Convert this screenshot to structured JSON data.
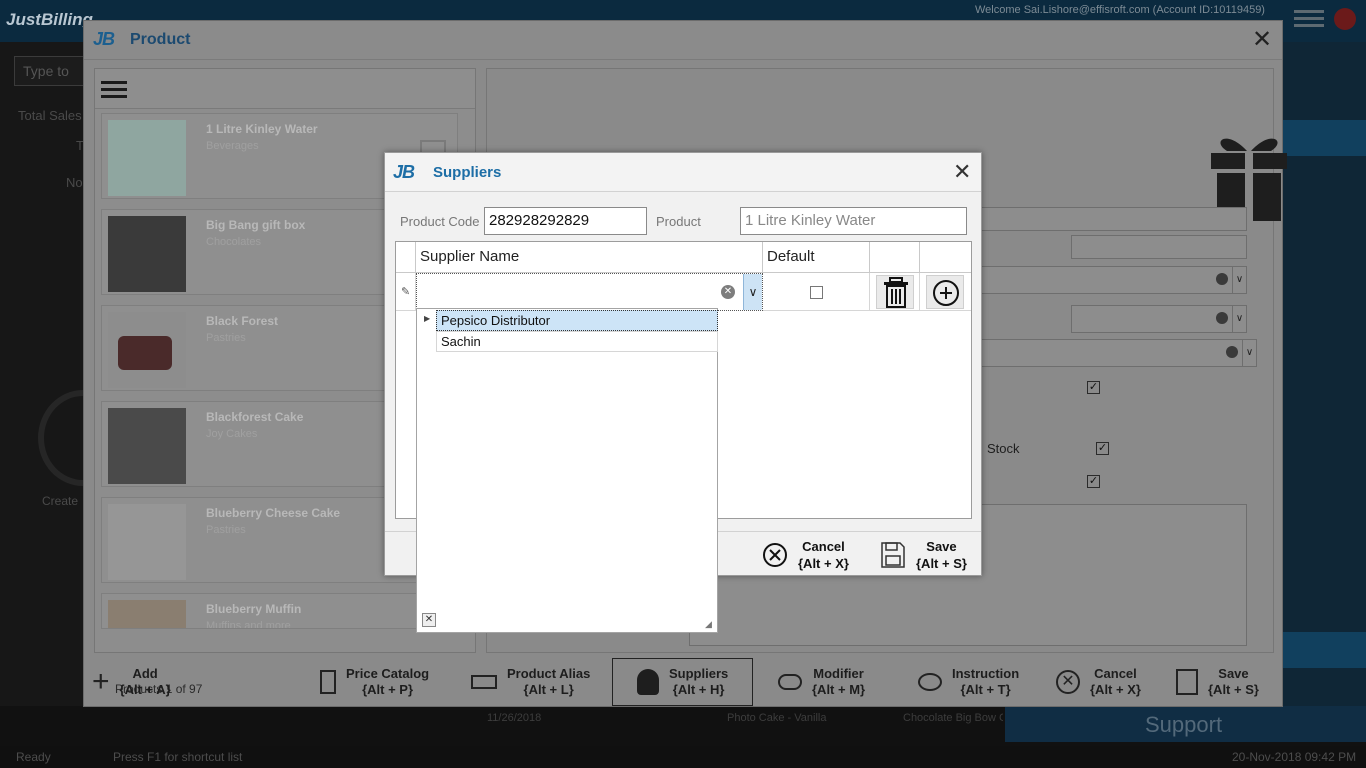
{
  "app": {
    "logo": "JustBilling",
    "welcome": "Welcome Sai.Lishore@effisroft.com (Account ID:10119459)",
    "search_placeholder": "Type to",
    "total_sales_label": "Total Sales",
    "left_short_1": "T",
    "left_short_2": "No",
    "create_label": "Create",
    "support_label": "Support",
    "status_ready": "Ready",
    "status_hint": "Press F1 for shortcut list",
    "status_datetime": "20-Nov-2018 09:42 PM",
    "bg_row": {
      "date": "11/26/2018",
      "col2": "Photo Cake - Vanilla",
      "col3": "Chocolate Big Bow C"
    }
  },
  "product_window": {
    "title": "Product",
    "close_glyph": "✕",
    "list": {
      "items": [
        {
          "name": "1 Litre Kinley Water",
          "category": "Beverages"
        },
        {
          "name": "Big Bang gift box",
          "category": "Chocolates"
        },
        {
          "name": "Black Forest",
          "category": "Pastries"
        },
        {
          "name": "Blackforest Cake",
          "category": "Joy Cakes"
        },
        {
          "name": "Blueberry Cheese Cake",
          "category": "Pastries"
        },
        {
          "name": "Blueberry Muffin",
          "category": "Muffins and more"
        }
      ],
      "footer": "Products 1 of 97"
    },
    "detail": {
      "stock_label": "Stock"
    },
    "toolbar": [
      {
        "label": "Add",
        "shortcut": "{Alt + A}",
        "icon": "plus-icon"
      },
      {
        "label": "Price Catalog",
        "shortcut": "{Alt + P}",
        "icon": "price-tag-icon"
      },
      {
        "label": "Product Alias",
        "shortcut": "{Alt + L}",
        "icon": "alias-tag-icon"
      },
      {
        "label": "Suppliers",
        "shortcut": "{Alt + H}",
        "icon": "supplier-person-icon"
      },
      {
        "label": "Modifier",
        "shortcut": "{Alt + M}",
        "icon": "modifier-icon"
      },
      {
        "label": "Instruction",
        "shortcut": "{Alt + T}",
        "icon": "instruction-icon"
      },
      {
        "label": "Cancel",
        "shortcut": "{Alt + X}",
        "icon": "cancel-icon"
      },
      {
        "label": "Save",
        "shortcut": "{Alt + S}",
        "icon": "save-icon"
      }
    ]
  },
  "suppliers_dialog": {
    "title": "Suppliers",
    "logo": "JB",
    "close_glyph": "✕",
    "product_code_label": "Product Code",
    "product_code_value": "282928292829",
    "product_label": "Product",
    "product_value": "1 Litre Kinley Water",
    "grid": {
      "columns": [
        "Supplier Name",
        "Default"
      ],
      "dropdown_options": [
        "Pepsico Distributor",
        "Sachin"
      ]
    },
    "cancel": {
      "label": "Cancel",
      "shortcut": "{Alt + X}"
    },
    "save": {
      "label": "Save",
      "shortcut": "{Alt + S}"
    }
  },
  "colors": {
    "accent": "#1d6ea6",
    "selection": "#cde4f7"
  }
}
